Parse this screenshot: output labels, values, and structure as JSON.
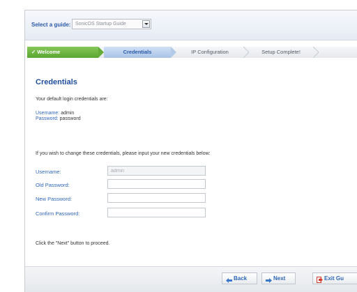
{
  "guide": {
    "label": "Select a guide:",
    "selected": "SonicOS Startup Guide"
  },
  "steps": [
    {
      "label": "✓ Welcome",
      "state": "done"
    },
    {
      "label": "Credentials",
      "state": "active"
    },
    {
      "label": "IP Configuration",
      "state": "pending"
    },
    {
      "label": "Setup Complete!",
      "state": "pending"
    }
  ],
  "content": {
    "title": "Credentials",
    "intro": "Your default login credentials are:",
    "username_label": "Username:",
    "username_value": "admin",
    "password_label": "Password:",
    "password_value": "password",
    "change_note": "If you wish to change these credentials, please input your new credentials below:",
    "proceed": "Click the \"Next\" button to proceed."
  },
  "form": {
    "fields": [
      {
        "label": "Username:",
        "value": "admin",
        "disabled": true
      },
      {
        "label": "Old Password:",
        "value": ""
      },
      {
        "label": "New Password:",
        "value": ""
      },
      {
        "label": "Confirm Password:",
        "value": ""
      }
    ]
  },
  "footer": {
    "back": "Back",
    "next": "Next",
    "exit": "Exit Gu"
  },
  "colors": {
    "accent_blue": "#2f66b8",
    "done_green": "#5aa62f",
    "exit_red": "#d23b2a"
  }
}
